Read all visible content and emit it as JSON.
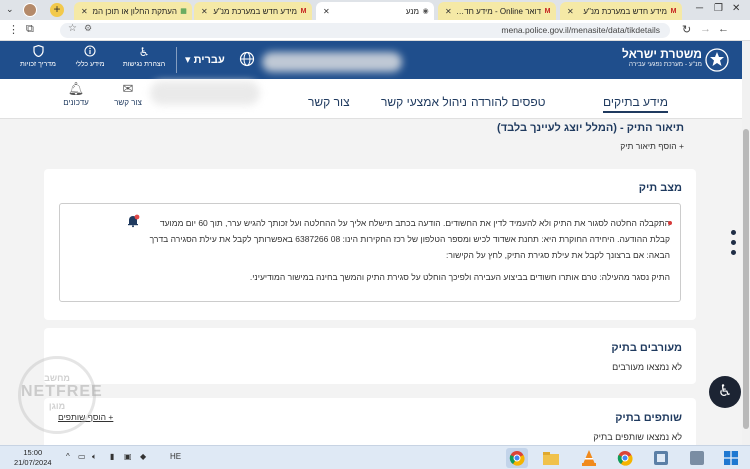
{
  "browser": {
    "tabs": [
      {
        "title": "מידע חדש במערכת מנ\"ע",
        "fav": "M",
        "style": "yellow"
      },
      {
        "title": "דואר Online - מידע חדש ב",
        "fav": "M",
        "style": "yellow"
      },
      {
        "title": "מנע",
        "fav": "◉",
        "style": "active"
      },
      {
        "title": "מידע חדש במערכת מנ\"ע",
        "fav": "M",
        "style": "yellow"
      },
      {
        "title": "העתקת החלון או תוכן המ",
        "fav": "▦",
        "style": "yellow"
      }
    ],
    "url": "mena.police.gov.il/menasite/data/tikdetails"
  },
  "header": {
    "brand_title": "משטרת ישראל",
    "brand_subtitle": "מנ\"ע - מערכת נפגעי עבירה",
    "language": "עברית",
    "items": [
      {
        "label": "הצהרת נגישות",
        "icon": "wheelchair-icon"
      },
      {
        "label": "מידע כללי",
        "icon": "info-icon"
      },
      {
        "label": "מדריך זכויות",
        "icon": "shield-icon"
      }
    ]
  },
  "nav": {
    "menu": [
      {
        "label": "מידע בתיקים",
        "active": true
      },
      {
        "label": "טפסים להורדה",
        "active": false
      },
      {
        "label": "ניהול אמצעי קשר",
        "active": false
      },
      {
        "label": "צור קשר",
        "active": false
      }
    ],
    "contact_label": "צור קשר",
    "updates_label": "עדכונים"
  },
  "case": {
    "description_title": "תיאור התיק - (המלל יוצג לעיינך בלבד)",
    "add_description": "+ הוסף תיאור תיק",
    "status_title": "מצב תיק",
    "status_paragraph1": "התקבלה החלטה לסגור את התיק ולא להעמיד לדין את החשודים. הודעה בכתב תישלח אליך על ההחלטה ועל זכותך להגיש ערר, תוך 60 יום ממועד קבלת ההודעה. היחידה החוקרת היא: תחנת אשדוד לכיש ומספר הטלפון של רכז החקירות הינו: 08 6387266 באפשרותך לקבל את עילת הסגירה בדרך הבאה: אם ברצונך לקבל את עילת סגירת התיק, לחץ על הקישור:",
    "status_paragraph2": "התיק נסגר מהעילה: טרם אותרו חשודים בביצוע העבירה ולפיכך הוחלט על סגירת התיק והמשך בחינה במישור המודיעיני.",
    "involved_title": "מעורבים בתיק",
    "involved_empty": "לא נמצאו מעורבים",
    "partners_title": "שותפים בתיק",
    "partners_empty": "לא נמצאו שותפים בתיק",
    "add_partners": "+ הוסף שותפים"
  },
  "watermark": {
    "line1": "מחשב",
    "line2": "NETFREE",
    "line3": "מוגן"
  },
  "taskbar": {
    "time": "15:00",
    "date": "21/07/2024",
    "lang": "HE"
  },
  "colors": {
    "brand_blue": "#1f4e8c",
    "nav_text": "#1f3a5f",
    "status_dot": "#d63a3a"
  }
}
